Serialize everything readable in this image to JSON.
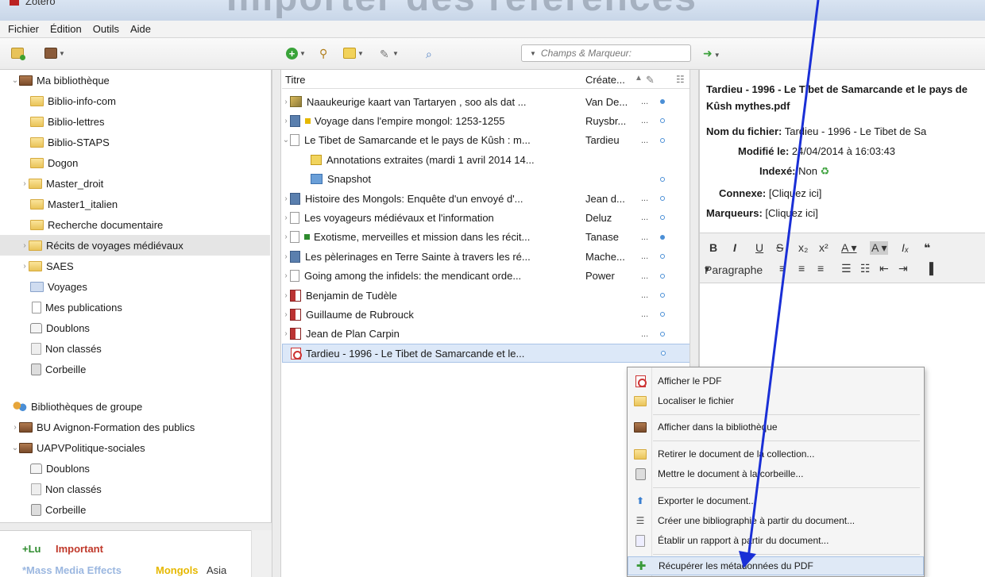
{
  "window": {
    "title": "Zotero",
    "banner": "Importer des références"
  },
  "menubar": [
    "Fichier",
    "Édition",
    "Outils",
    "Aide"
  ],
  "toolbar": {
    "search_placeholder": "Champs & Marqueur:"
  },
  "collections": {
    "my_library": "Ma bibliothèque",
    "items": [
      {
        "label": "Biblio-info-com",
        "expandable": false
      },
      {
        "label": "Biblio-lettres",
        "expandable": false
      },
      {
        "label": "Biblio-STAPS",
        "expandable": false
      },
      {
        "label": "Dogon",
        "expandable": false
      },
      {
        "label": "Master_droit",
        "expandable": true
      },
      {
        "label": "Master1_italien",
        "expandable": false
      },
      {
        "label": "Recherche documentaire",
        "expandable": false
      },
      {
        "label": "Récits de voyages médiévaux",
        "expandable": true
      },
      {
        "label": "SAES",
        "expandable": true
      },
      {
        "label": "Voyages",
        "expandable": false
      }
    ],
    "my_publications": "Mes publications",
    "duplicates": "Doublons",
    "unfiled": "Non classés",
    "trash": "Corbeille",
    "group_libraries": "Bibliothèques de groupe",
    "groups": [
      "BU Avignon-Formation des publics",
      "UAPVPolitique-sociales"
    ],
    "group_sub": {
      "duplicates": "Doublons",
      "unfiled": "Non classés",
      "trash": "Corbeille"
    }
  },
  "tags": {
    "row1": [
      {
        "label": "+Lu",
        "color": "#2e8b2e"
      },
      {
        "label": "Important",
        "color": "#c0392b"
      }
    ],
    "row2": [
      {
        "label": "*Mass Media Effects",
        "color": "#9bb7e0"
      },
      {
        "label": "Mongols",
        "color": "#e6b800"
      },
      {
        "label": "Asia",
        "color": "#333333"
      }
    ]
  },
  "columns": {
    "title": "Titre",
    "creator": "Créate..."
  },
  "items": [
    {
      "title": "Naaukeurige kaart van Tartaryen , soo als dat ...",
      "creator": "Van De...",
      "type": "map",
      "dot": "full",
      "indent": 0,
      "tag": ""
    },
    {
      "title": "Voyage dans l'empire mongol: 1253-1255",
      "creator": "Ruysbr...",
      "type": "book",
      "dot": "empty",
      "indent": 0,
      "tag": "#e6b800"
    },
    {
      "title": "Le Tibet de Samarcande et le pays de Kûsh : m...",
      "creator": "Tardieu",
      "type": "doc",
      "dot": "empty",
      "indent": 0,
      "tag": ""
    },
    {
      "title": "Annotations extraites (mardi 1 avril 2014 14...",
      "creator": "",
      "type": "annot",
      "dot": "",
      "indent": 1,
      "tag": ""
    },
    {
      "title": "Snapshot",
      "creator": "",
      "type": "snap",
      "dot": "empty",
      "indent": 1,
      "tag": ""
    },
    {
      "title": "Histoire des Mongols: Enquête d'un envoyé d'...",
      "creator": "Jean d...",
      "type": "book",
      "dot": "empty",
      "indent": 0,
      "tag": ""
    },
    {
      "title": "Les voyageurs médiévaux et l'information",
      "creator": "Deluz",
      "type": "doc",
      "dot": "empty",
      "indent": 0,
      "tag": ""
    },
    {
      "title": "Exotisme, merveilles et mission dans les récit...",
      "creator": "Tanase",
      "type": "doc",
      "dot": "full",
      "indent": 0,
      "tag": "#2e8b2e"
    },
    {
      "title": "Les pèlerinages en Terre Sainte à travers les ré...",
      "creator": "Mache...",
      "type": "book",
      "dot": "empty",
      "indent": 0,
      "tag": ""
    },
    {
      "title": "Going among the infidels: the mendicant orde...",
      "creator": "Power",
      "type": "doc",
      "dot": "empty",
      "indent": 0,
      "tag": ""
    },
    {
      "title": "Benjamin de Tudèle",
      "creator": "",
      "type": "person",
      "dot": "empty",
      "indent": 0,
      "tag": ""
    },
    {
      "title": "Guillaume de Rubrouck",
      "creator": "",
      "type": "person",
      "dot": "empty",
      "indent": 0,
      "tag": ""
    },
    {
      "title": "Jean de Plan Carpin",
      "creator": "",
      "type": "person",
      "dot": "empty",
      "indent": 0,
      "tag": ""
    },
    {
      "title": "Tardieu - 1996 - Le Tibet de Samarcande et le...",
      "creator": "",
      "type": "pdf",
      "dot": "empty",
      "indent": 0,
      "tag": ""
    }
  ],
  "item_ellipsis": "...",
  "attachment": {
    "title": "Tardieu - 1996 - Le Tibet de Samarcande et le pays de Kûsh mythes.pdf",
    "filename_label": "Nom du fichier:",
    "filename_value": "Tardieu - 1996 - Le Tibet de Sa",
    "modified_label": "Modifié le:",
    "modified_value": "24/04/2014 à 16:03:43",
    "indexed_label": "Indexé:",
    "indexed_value": "Non",
    "related_label": "Connexe:",
    "related_value": "[Cliquez ici]",
    "tags_label": "Marqueurs:",
    "tags_value": "[Cliquez ici]"
  },
  "editor": {
    "paragraph_label": "Paragraphe"
  },
  "context_menu": [
    {
      "label": "Afficher le PDF",
      "icon": "pdf"
    },
    {
      "label": "Localiser le fichier",
      "icon": "folder"
    },
    {
      "label": "Afficher dans la bibliothèque",
      "icon": "library"
    },
    {
      "label": "Retirer le document de la collection...",
      "icon": "remove"
    },
    {
      "label": "Mettre le document à la corbeille...",
      "icon": "trash"
    },
    {
      "label": "Exporter le document...",
      "icon": "export"
    },
    {
      "label": "Créer une bibliographie à partir du document...",
      "icon": "bib"
    },
    {
      "label": "Établir un rapport à partir du document...",
      "icon": "report"
    },
    {
      "label": "Récupérer les métadonnées du PDF",
      "icon": "puzzle"
    }
  ],
  "colors": {
    "selection": "#dce8f8",
    "arrow": "#1a2fd6",
    "accent_blue": "#4b8fd6"
  }
}
